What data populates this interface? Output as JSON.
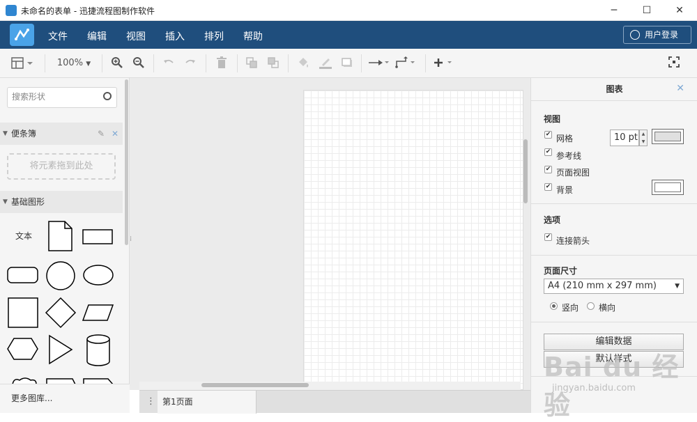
{
  "window": {
    "title": "未命名的表单 - 迅捷流程图制作软件",
    "controls": {
      "minimize": "─",
      "maximize": "☐",
      "close": "✕"
    }
  },
  "menubar": {
    "items": [
      "文件",
      "编辑",
      "视图",
      "插入",
      "排列",
      "帮助"
    ],
    "login": "用户登录",
    "colors": {
      "bar": "#1f4e7d",
      "logo": "#4aa3e8"
    }
  },
  "toolbar": {
    "zoom": "100%",
    "icons": [
      "page-layout-icon",
      "zoom-in-icon",
      "zoom-out-icon",
      "undo-icon",
      "redo-icon",
      "delete-icon",
      "to-front-icon",
      "to-back-icon",
      "fill-color-icon",
      "line-color-icon",
      "shadow-icon",
      "connection-icon",
      "waypoint-icon",
      "insert-icon",
      "fullscreen-icon"
    ]
  },
  "left_panel": {
    "search_placeholder": "搜索形状",
    "scratchpad_title": "便条簿",
    "drop_zone": "将元素拖到此处",
    "basic_shapes_title": "基础图形",
    "text_shape": "文本",
    "more_libraries": "更多图库..."
  },
  "page_tabs": {
    "current": "第1页面"
  },
  "right_panel": {
    "title": "图表",
    "view_section": "视图",
    "grid_label": "网格",
    "grid_size": "10 pt",
    "guides_label": "参考线",
    "page_view_label": "页面视图",
    "background_label": "背景",
    "options_section": "选项",
    "connection_arrows_label": "连接箭头",
    "page_size_section": "页面尺寸",
    "page_size": "A4 (210 mm x 297 mm)",
    "portrait": "竖向",
    "landscape": "横向",
    "edit_data_button": "编辑数据",
    "default_style_button": "默认样式"
  },
  "watermark": {
    "brand": "Bai du 经验",
    "url": "jingyan.baidu.com"
  }
}
